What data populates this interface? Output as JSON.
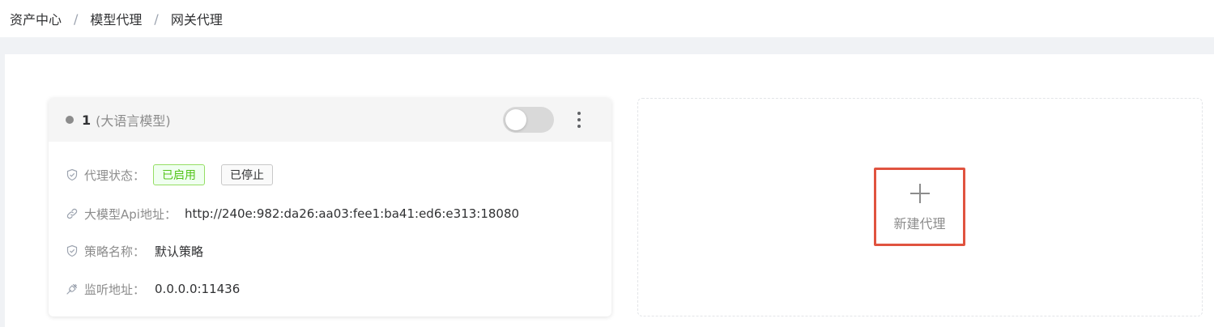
{
  "breadcrumb": {
    "items": [
      "资产中心",
      "模型代理",
      "网关代理"
    ],
    "separator": "/"
  },
  "card": {
    "number": "1",
    "type": "(大语言模型)",
    "status_dot_color": "#8c8c8c",
    "toggle_on": false,
    "rows": [
      {
        "icon": "shield-check-icon",
        "label": "代理状态："
      },
      {
        "icon": "link-icon",
        "label": "大模型Api地址：",
        "value": "http://240e:982:da26:aa03:fee1:ba41:ed6:e313:18080"
      },
      {
        "icon": "shield-check-icon",
        "label": "策略名称：",
        "value": "默认策略"
      },
      {
        "icon": "plug-icon",
        "label": "监听地址：",
        "value": "0.0.0.0:11436"
      }
    ],
    "status_tags": {
      "enabled": "已启用",
      "stopped": "已停止"
    }
  },
  "new_proxy": {
    "label": "新建代理",
    "icon": "plus-icon",
    "highlight_color": "#e0533f"
  }
}
